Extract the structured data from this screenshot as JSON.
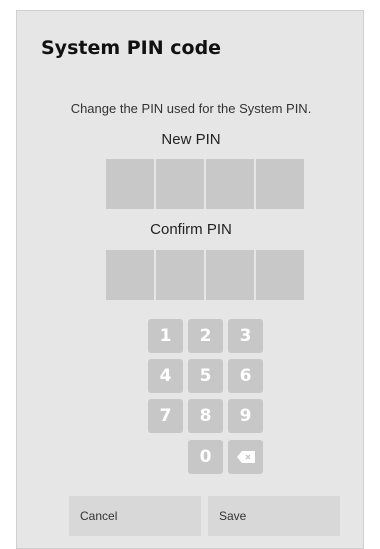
{
  "dialog": {
    "title": "System PIN code",
    "description": "Change the PIN used for the System PIN.",
    "new_pin_label": "New PIN",
    "confirm_pin_label": "Confirm PIN",
    "new_pin_digits": [
      "",
      "",
      "",
      ""
    ],
    "confirm_pin_digits": [
      "",
      "",
      "",
      ""
    ]
  },
  "keypad": {
    "keys": [
      "1",
      "2",
      "3",
      "4",
      "5",
      "6",
      "7",
      "8",
      "9",
      "0"
    ],
    "backspace_icon": "backspace-icon"
  },
  "buttons": {
    "cancel": "Cancel",
    "save": "Save"
  },
  "colors": {
    "dialog_bg": "#e6e6e6",
    "pin_box": "#c8c8c8",
    "key_bg": "#c7c7c7",
    "button_bg": "#d8d8d8"
  }
}
